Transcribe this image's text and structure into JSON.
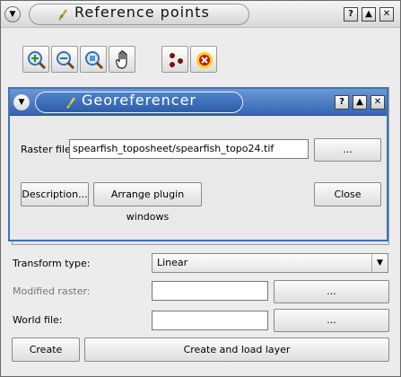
{
  "reference_window": {
    "title": "Reference points",
    "titlebar_buttons": {
      "help": "?",
      "shade": "▲",
      "close": "✕"
    },
    "menu_icon": "chevron-down-icon",
    "tools": [
      "zoom-in-icon",
      "zoom-out-icon",
      "zoom-to-layer-icon",
      "pan-hand-icon",
      "add-point-icon",
      "delete-point-icon"
    ],
    "transform_label": "Transform type:",
    "transform_value": "Linear",
    "modified_raster_label": "Modified raster:",
    "modified_raster_value": "",
    "modified_browse": "...",
    "world_file_label": "World file:",
    "world_file_value": "",
    "world_browse": "...",
    "create_button": "Create",
    "create_load_button": "Create and load layer"
  },
  "georeferencer_window": {
    "title": "Georeferencer",
    "titlebar_buttons": {
      "help": "?",
      "shade": "▲",
      "close": "✕"
    },
    "raster_label": "Raster file:",
    "raster_value": "spearfish_toposheet/spearfish_topo24.tif",
    "browse_button": "...",
    "description_button": "Description...",
    "arrange_button": "Arrange plugin windows",
    "close_button": "Close"
  },
  "colors": {
    "active_titlebar": "#3f73b8",
    "inactive_titlebar": "#d9d9d9",
    "delete_icon_red": "#cc1010",
    "delete_icon_yellow": "#f3d21a"
  }
}
